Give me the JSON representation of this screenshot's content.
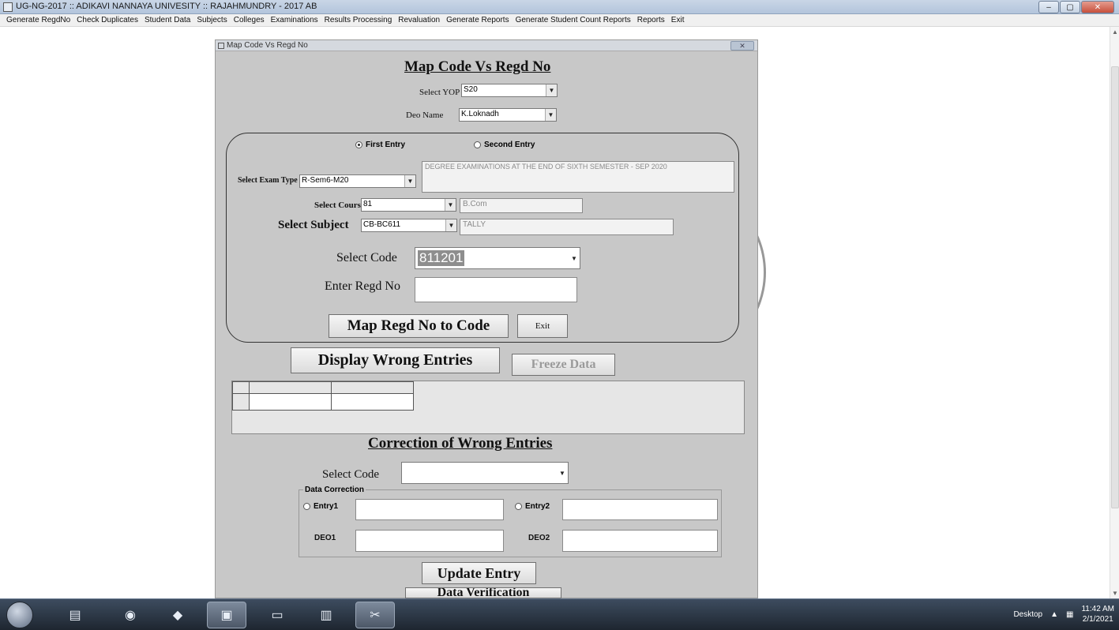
{
  "window": {
    "title": "UG-NG-2017 :: ADIKAVI NANNAYA UNIVESITY :: RAJAHMUNDRY - 2017 AB",
    "buttons": {
      "minimize": "–",
      "maximize": "▢",
      "close": "✕"
    }
  },
  "menu": {
    "items": [
      {
        "label": "Generate RegdNo"
      },
      {
        "label": "Check Duplicates"
      },
      {
        "label": "Student Data"
      },
      {
        "label": "Subjects"
      },
      {
        "label": "Colleges"
      },
      {
        "label": "Examinations"
      },
      {
        "label": "Results Processing"
      },
      {
        "label": "Revaluation"
      },
      {
        "label": "Generate Reports"
      },
      {
        "label": "Generate Student Count Reports"
      },
      {
        "label": "Reports"
      },
      {
        "label": "Exit"
      }
    ]
  },
  "form": {
    "title": "Map Code Vs Regd No",
    "heading": "Map Code Vs Regd No",
    "yop": {
      "label": "Select YOP",
      "value": "S20"
    },
    "deo": {
      "label": "Deo Name",
      "value": "K.Loknadh"
    },
    "entry": {
      "first": "First Entry",
      "second": "Second Entry",
      "selected": "first"
    },
    "exam_type": {
      "label": "Select Exam Type",
      "value": "R-Sem6-M20",
      "description": "DEGREE EXAMINATIONS AT THE END OF SIXTH SEMESTER - SEP 2020"
    },
    "course": {
      "label": "Select Course",
      "value": "81",
      "name": "B.Com"
    },
    "subject": {
      "label": "Select Subject",
      "value": "CB-BC611",
      "name": "TALLY"
    },
    "code": {
      "label": "Select Code",
      "value": "811201"
    },
    "regd": {
      "label": "Enter Regd No",
      "value": ""
    },
    "map_button": "Map Regd No to Code",
    "exit_button": "Exit",
    "display_button": "Display Wrong Entries",
    "freeze_button": "Freeze Data",
    "correction": {
      "heading": "Correction of Wrong Entries",
      "select_code_label": "Select Code",
      "select_code_value": "",
      "group_label": "Data Correction",
      "entry1": "Entry1",
      "entry2": "Entry2",
      "deo1": "DEO1",
      "deo2": "DEO2",
      "update_button": "Update Entry",
      "verify_button": "Data Verification"
    }
  },
  "taskbar": {
    "desktop_label": "Desktop",
    "time": "11:42 AM",
    "date": "2/1/2021"
  }
}
